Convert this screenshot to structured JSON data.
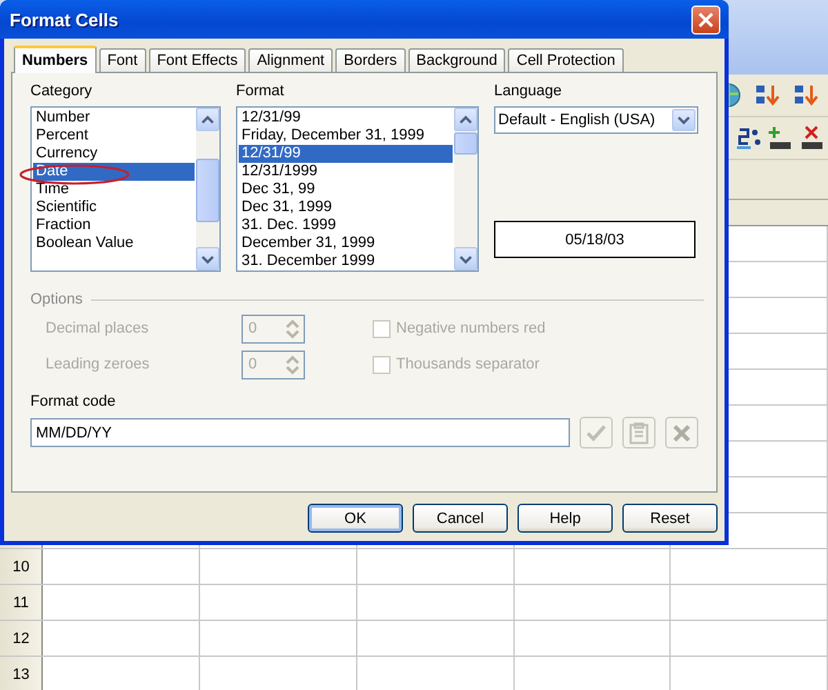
{
  "window": {
    "title": "Format Cells"
  },
  "tabs": [
    {
      "label": "Numbers",
      "selected": true
    },
    {
      "label": "Font",
      "selected": false
    },
    {
      "label": "Font Effects",
      "selected": false
    },
    {
      "label": "Alignment",
      "selected": false
    },
    {
      "label": "Borders",
      "selected": false
    },
    {
      "label": "Background",
      "selected": false
    },
    {
      "label": "Cell Protection",
      "selected": false
    }
  ],
  "category": {
    "label": "Category",
    "items": [
      {
        "label": "Number",
        "selected": false
      },
      {
        "label": "Percent",
        "selected": false
      },
      {
        "label": "Currency",
        "selected": false
      },
      {
        "label": "Date",
        "selected": true
      },
      {
        "label": "Time",
        "selected": false
      },
      {
        "label": "Scientific",
        "selected": false
      },
      {
        "label": "Fraction",
        "selected": false
      },
      {
        "label": "Boolean Value",
        "selected": false
      }
    ]
  },
  "format": {
    "label": "Format",
    "items": [
      {
        "label": "12/31/99",
        "selected": false
      },
      {
        "label": "Friday, December 31, 1999",
        "selected": false
      },
      {
        "label": "12/31/99",
        "selected": true
      },
      {
        "label": "12/31/1999",
        "selected": false
      },
      {
        "label": "Dec 31, 99",
        "selected": false
      },
      {
        "label": "Dec 31, 1999",
        "selected": false
      },
      {
        "label": "31. Dec. 1999",
        "selected": false
      },
      {
        "label": "December 31, 1999",
        "selected": false
      },
      {
        "label": "31. December 1999",
        "selected": false
      }
    ]
  },
  "language": {
    "label": "Language",
    "value": "Default - English (USA)"
  },
  "preview": "05/18/03",
  "options": {
    "title": "Options",
    "fields": [
      {
        "label": "Decimal places",
        "value": "0",
        "disabled": true
      },
      {
        "label": "Leading zeroes",
        "value": "0",
        "disabled": true
      }
    ],
    "checkboxes": [
      {
        "label": "Negative numbers red",
        "checked": false,
        "disabled": true
      },
      {
        "label": "Thousands separator",
        "checked": false,
        "disabled": true
      }
    ]
  },
  "format_code": {
    "label": "Format code",
    "value": "MM/DD/YY",
    "buttons": [
      {
        "kind": "check",
        "disabled": true
      },
      {
        "kind": "comment",
        "disabled": true
      },
      {
        "kind": "delete",
        "disabled": true
      }
    ]
  },
  "buttons": [
    {
      "label": "OK",
      "default": true
    },
    {
      "label": "Cancel",
      "default": false
    },
    {
      "label": "Help",
      "default": false
    },
    {
      "label": "Reset",
      "default": false
    }
  ],
  "sheet": {
    "rows": [
      "10",
      "11",
      "12",
      "13"
    ]
  }
}
